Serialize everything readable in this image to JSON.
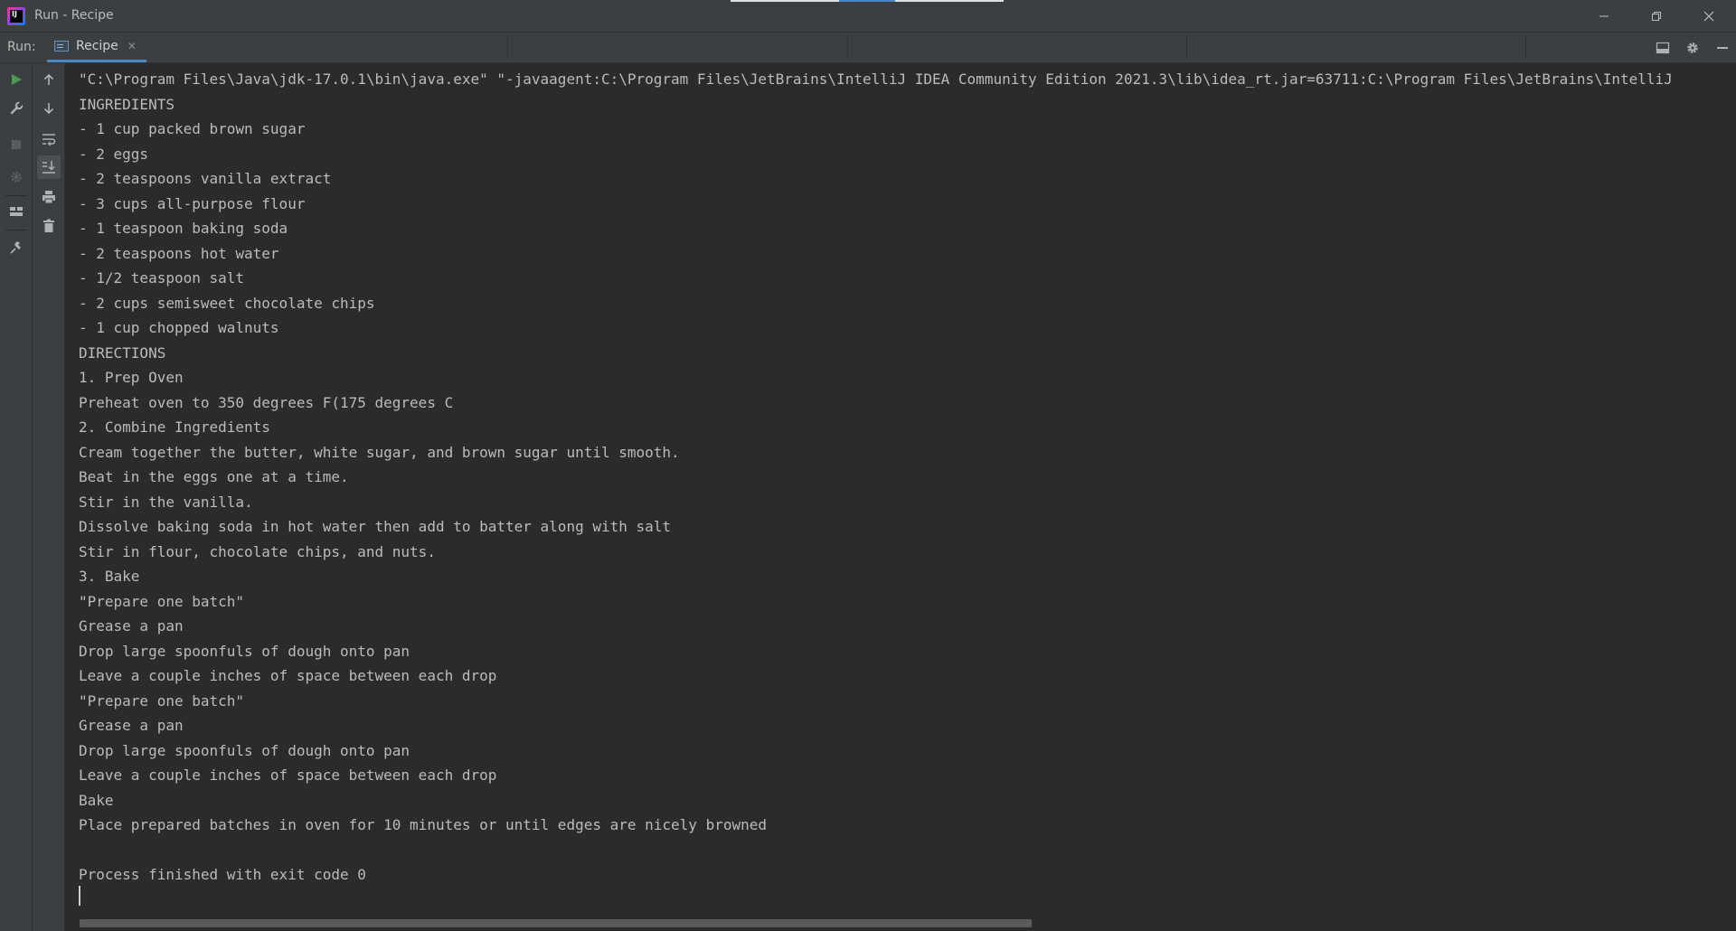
{
  "window": {
    "title": "Run - Recipe",
    "app_icon_text": "IJ"
  },
  "toolbar": {
    "run_label": "Run:",
    "tab_label": "Recipe"
  },
  "console": {
    "lines": [
      "\"C:\\Program Files\\Java\\jdk-17.0.1\\bin\\java.exe\" \"-javaagent:C:\\Program Files\\JetBrains\\IntelliJ IDEA Community Edition 2021.3\\lib\\idea_rt.jar=63711:C:\\Program Files\\JetBrains\\IntelliJ",
      "INGREDIENTS",
      "- 1 cup packed brown sugar",
      "- 2 eggs",
      "- 2 teaspoons vanilla extract",
      "- 3 cups all-purpose flour",
      "- 1 teaspoon baking soda",
      "- 2 teaspoons hot water",
      "- 1/2 teaspoon salt",
      "- 2 cups semisweet chocolate chips",
      "- 1 cup chopped walnuts",
      "DIRECTIONS",
      "1. Prep Oven",
      "Preheat oven to 350 degrees F(175 degrees C",
      "2. Combine Ingredients",
      "Cream together the butter, white sugar, and brown sugar until smooth.",
      "Beat in the eggs one at a time.",
      "Stir in the vanilla.",
      "Dissolve baking soda in hot water then add to batter along with salt",
      "Stir in flour, chocolate chips, and nuts.",
      "3. Bake",
      "\"Prepare one batch\"",
      "Grease a pan",
      "Drop large spoonfuls of dough onto pan",
      "Leave a couple inches of space between each drop",
      "\"Prepare one batch\"",
      "Grease a pan",
      "Drop large spoonfuls of dough onto pan",
      "Leave a couple inches of space between each drop",
      "Bake",
      "Place prepared batches in oven for 10 minutes or until edges are nicely browned",
      "",
      "Process finished with exit code 0"
    ]
  },
  "colors": {
    "background": "#2b2b2b",
    "panel": "#3c3f41",
    "text": "#bbbbbb",
    "tab_accent": "#4a88c7",
    "run_green": "#499c54"
  },
  "icons": {
    "left_toolbar": [
      "rerun-icon",
      "wrench-icon",
      "stop-icon",
      "debug-settings-icon",
      "layout-icon",
      "pin-icon"
    ],
    "console_toolbar": [
      "arrow-up-icon",
      "arrow-down-icon",
      "soft-wrap-icon",
      "scroll-to-end-icon",
      "print-icon",
      "trash-icon"
    ],
    "right_toolbar": [
      "layout-icon",
      "gear-icon",
      "minimize-icon"
    ]
  }
}
